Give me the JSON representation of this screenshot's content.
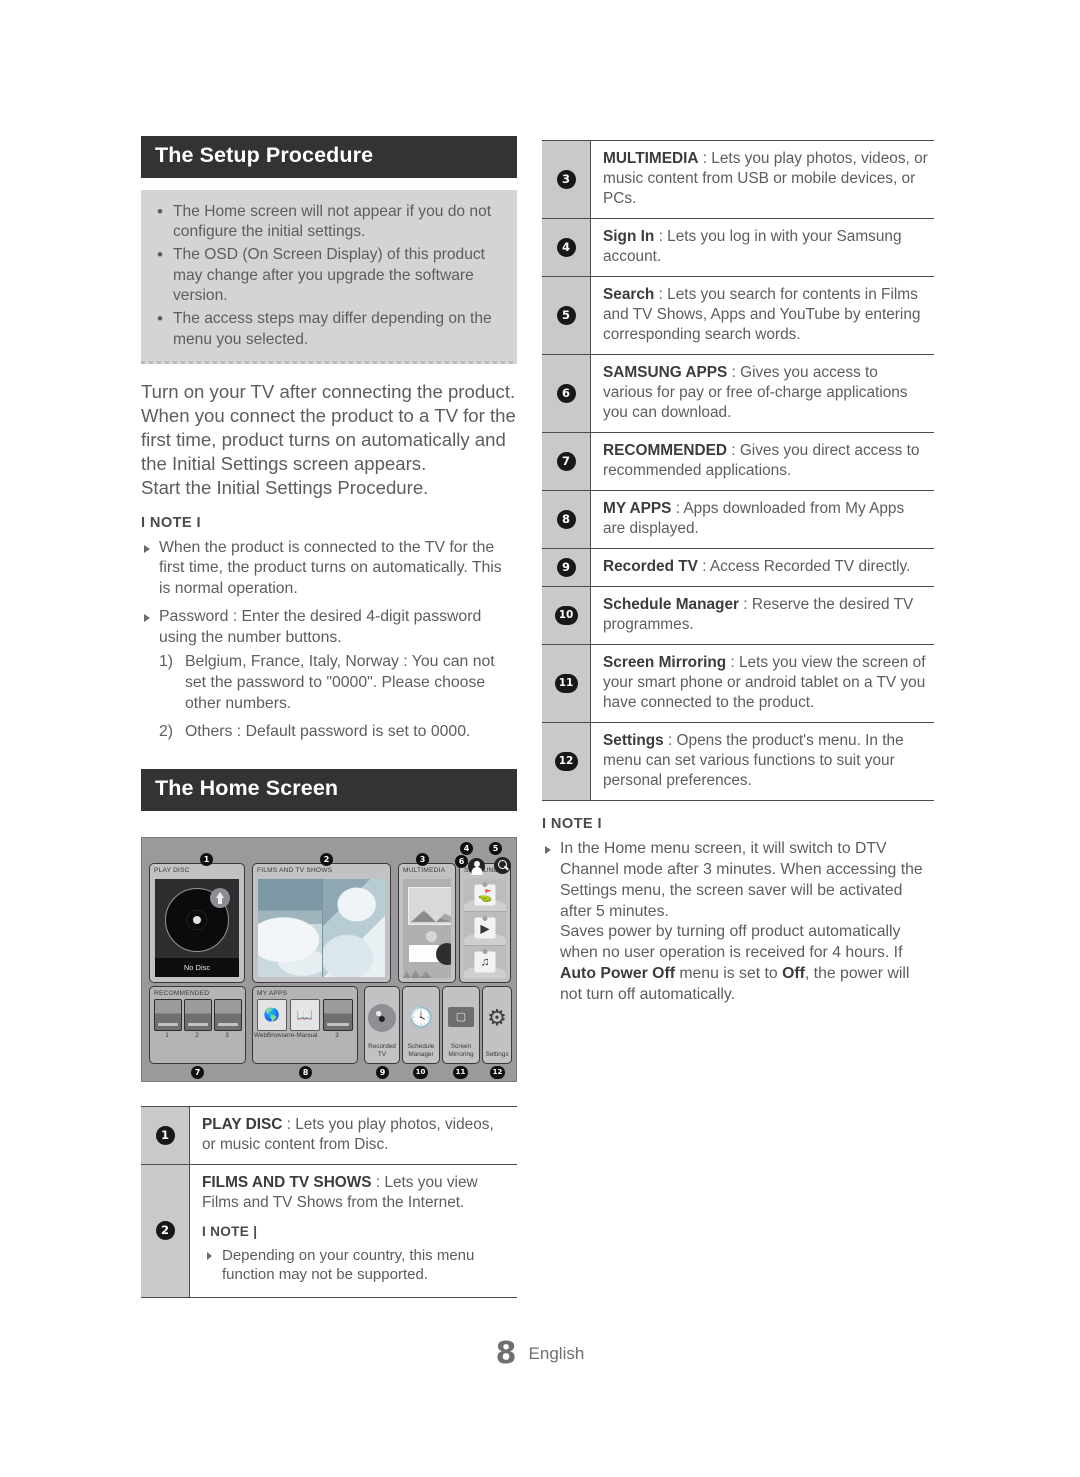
{
  "sections": {
    "setup_title": "The Setup Procedure",
    "home_title": "The Home Screen"
  },
  "callout_bullets": [
    "The Home screen will not appear if you do not configure the initial settings.",
    "The OSD (On Screen Display) of this product may change after you upgrade the software version.",
    "The access steps may differ depending on the menu you selected."
  ],
  "body_paragraph": "Turn on your TV after connecting the product. When you connect the product to a TV for the first time, product turns on automatically and the Initial Settings screen appears.\nStart the Initial Settings Procedure.",
  "note_label": "I NOTE I",
  "note_label_alt": "I NOTE |",
  "left_notes": {
    "item1": "When the product is connected to the TV for the first time, the product turns on automatically. This is normal operation.",
    "item2": "Password : Enter the desired 4-digit password using the number buttons.",
    "sub1_num": "1)",
    "sub1_text": "Belgium, France, Italy, Norway : You can not set the password to \"0000\". Please choose other numbers.",
    "sub2_num": "2)",
    "sub2_text": "Others : Default password is set to 0000."
  },
  "right_notes": {
    "para1": "In the Home menu screen, it will switch to DTV Channel mode after 3 minutes. When accessing the Settings menu, the screen saver will be activated after 5 minutes.",
    "para2_a": "Saves power by turning off product automatically when no user operation is received for 4 hours. If ",
    "para2_b": "Auto Power Off",
    "para2_c": " menu is set to ",
    "para2_d": "Off",
    "para2_e": ", the power will not turn off automatically."
  },
  "right_table": [
    {
      "num": "3",
      "bold": "MULTIMEDIA",
      "sep": " : ",
      "text": "Lets you play photos, videos, or music content from USB or mobile devices, or PCs."
    },
    {
      "num": "4",
      "bold": "Sign In",
      "sep": " : ",
      "text": "Lets you log in with your Samsung account."
    },
    {
      "num": "5",
      "bold": "Search",
      "sep": " : ",
      "text": "Lets you search for contents in Films and TV Shows, Apps and YouTube by entering corresponding search words."
    },
    {
      "num": "6",
      "bold": "SAMSUNG APPS",
      "sep": " : ",
      "text": "Gives you access to various for pay or free of-charge applications you can download."
    },
    {
      "num": "7",
      "bold": "RECOMMENDED",
      "sep": " : ",
      "text": "Gives you direct access to recommended applications."
    },
    {
      "num": "8",
      "bold": "MY APPS",
      "sep": " : ",
      "text": "Apps downloaded from My Apps are displayed."
    },
    {
      "num": "9",
      "bold": "Recorded TV",
      "sep": " : ",
      "text": "Access Recorded TV directly."
    },
    {
      "num": "10",
      "bold": "Schedule Manager",
      "sep": " : ",
      "text": "Reserve the desired TV programmes."
    },
    {
      "num": "11",
      "bold": "Screen Mirroring",
      "sep": " : ",
      "text": "Lets you view the screen of your smart phone or android tablet on a TV you have connected to the product."
    },
    {
      "num": "12",
      "bold": "Settings",
      "sep": " : ",
      "text": "Opens the product's menu. In the menu can set various functions to suit your personal preferences."
    }
  ],
  "left_table": {
    "row1": {
      "num": "1",
      "bold": "PLAY DISC",
      "sep": " : ",
      "text": "Lets you play photos, videos, or music content from Disc."
    },
    "row2": {
      "num": "2",
      "bold": "FILMS AND TV SHOWS",
      "sep": " : ",
      "text": "Lets you view Films and TV Shows from the Internet.",
      "note_bullet": "Depending on your country, this menu function may not be supported."
    }
  },
  "tv_mock": {
    "play_disc_label": "PLAY DISC",
    "no_disc": "No Disc",
    "films_label": "FILMS AND TV SHOWS",
    "multimedia_label": "MULTIMEDIA",
    "samsung_apps_label": "SAMSUNG APPS",
    "recommended_label": "RECOMMENDED",
    "my_apps_label": "MY APPS",
    "rec1": "1",
    "rec2": "2",
    "rec3": "3",
    "app1": "WebBrowser",
    "app2": "e-Manual",
    "app3": "3",
    "recorded_tv": "Recorded\nTV",
    "schedule_manager": "Schedule\nManager",
    "screen_mirroring": "Screen\nMirroring",
    "settings": "Settings",
    "markers": [
      "1",
      "2",
      "3",
      "4",
      "5",
      "6",
      "7",
      "8",
      "9",
      "10",
      "11",
      "12"
    ],
    "icons": {
      "avatar": "avatar-icon",
      "search": "search-icon",
      "disc": "disc-icon",
      "gear": "gear-icon",
      "clock": "clock-icon",
      "mirror": "screen-mirroring-icon"
    }
  },
  "footer": {
    "page_number": "8",
    "language": "English"
  }
}
